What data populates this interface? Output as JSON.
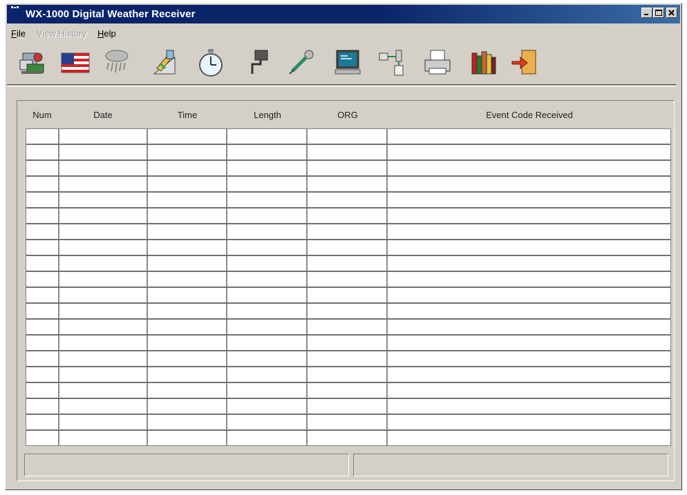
{
  "window": {
    "title": "WX-1000 Digital Weather Receiver"
  },
  "menu": [
    {
      "label": "File",
      "hotkey": "F",
      "rest": "ile",
      "enabled": true
    },
    {
      "label": "View History",
      "hotkey": "",
      "rest": "View History",
      "enabled": false
    },
    {
      "label": "Help",
      "hotkey": "H",
      "rest": "elp",
      "enabled": true
    }
  ],
  "toolbar": {
    "buttons": [
      {
        "name": "station-icon"
      },
      {
        "name": "flag-icon"
      },
      {
        "name": "storm-icon"
      },
      {
        "name": "edit-icon"
      },
      {
        "name": "stopwatch-icon"
      },
      {
        "name": "relay-icon"
      },
      {
        "name": "microphone-icon"
      },
      {
        "name": "monitor-icon"
      },
      {
        "name": "network-icon"
      },
      {
        "name": "printer-icon"
      },
      {
        "name": "books-icon"
      },
      {
        "name": "exit-icon"
      }
    ]
  },
  "table": {
    "columns": [
      "Num",
      "Date",
      "Time",
      "Length",
      "ORG",
      "Event Code Received"
    ],
    "row_count": 20,
    "rows": []
  },
  "statusbar": {
    "left": "",
    "right": ""
  },
  "colors": {
    "titlebar": "#0a246a",
    "face": "#d4d0c8"
  }
}
